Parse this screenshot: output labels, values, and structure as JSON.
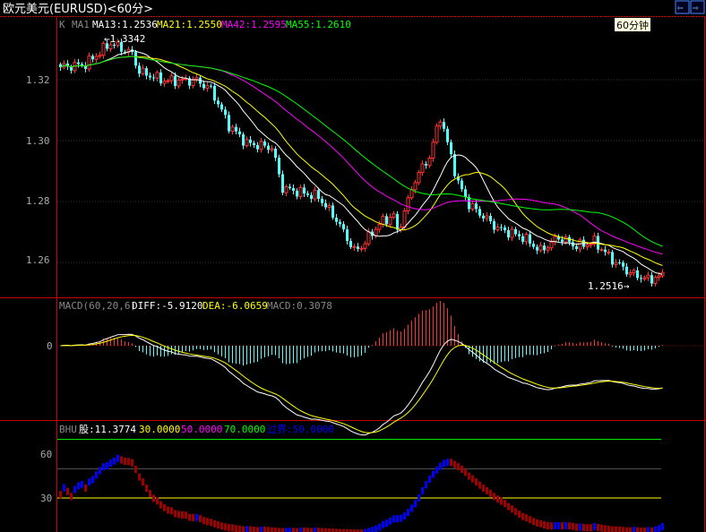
{
  "header": {
    "title": "欧元美元(EURUSD)<60分>",
    "period_badge": "60分钟",
    "nav_left_icon": "arrow-left-icon",
    "nav_right_icon": "arrow-right-icon"
  },
  "main_legend": {
    "k": "K",
    "ma1": "MA1",
    "ma13": "MA13:1.2536",
    "ma21": "MA21:1.2550",
    "ma42": "MA42:1.2595",
    "ma55": "MA55:1.2610"
  },
  "macd_legend": {
    "name": "MACD(60,20,6)",
    "diff": "DIFF:-5.9120",
    "dea": "DEA:-6.0659",
    "macd": "MACD:0.3078"
  },
  "bhu_legend": {
    "name": "BHU",
    "gu": "股:11.3774",
    "l30": "30.0000",
    "l50": "50.0000",
    "l70": "70.0000",
    "cross": "过界:50.0000"
  },
  "colors": {
    "up": "#ff3232",
    "down": "#54ffff",
    "ma13": "#ffffff",
    "ma21": "#ffff00",
    "ma42": "#ff00ff",
    "ma55": "#00ff00",
    "grid": "#ff0000",
    "bhu_up": "#0000ff",
    "bhu_down": "#a00000"
  },
  "chart_data": [
    {
      "type": "candlestick",
      "title": "欧元美元(EURUSD) 60分",
      "y_ticks": [
        "1.32",
        "1.30",
        "1.28",
        "1.26"
      ],
      "y_tick_values": [
        1.32,
        1.3,
        1.28,
        1.26
      ],
      "ylim": [
        1.2488,
        1.341
      ],
      "annotations": {
        "high": "1.3342",
        "low": "1.2516"
      },
      "close_keypoints": [
        [
          0,
          1.3241
        ],
        [
          7,
          1.325
        ],
        [
          14,
          1.332
        ],
        [
          20,
          1.3285
        ],
        [
          22,
          1.3226
        ],
        [
          29,
          1.3197
        ],
        [
          38,
          1.3197
        ],
        [
          42,
          1.3168
        ],
        [
          47,
          1.305
        ],
        [
          52,
          1.2991
        ],
        [
          59,
          1.2977
        ],
        [
          62,
          1.2844
        ],
        [
          67,
          1.283
        ],
        [
          72,
          1.2815
        ],
        [
          77,
          1.2741
        ],
        [
          82,
          1.2638
        ],
        [
          84,
          1.2653
        ],
        [
          89,
          1.2727
        ],
        [
          93,
          1.2756
        ],
        [
          94,
          1.2697
        ],
        [
          99,
          1.2874
        ],
        [
          103,
          1.2947
        ],
        [
          106,
          1.3079
        ],
        [
          108,
          1.2991
        ],
        [
          111,
          1.2859
        ],
        [
          114,
          1.2791
        ],
        [
          122,
          1.2712
        ],
        [
          129,
          1.2683
        ],
        [
          134,
          1.2638
        ],
        [
          139,
          1.2683
        ],
        [
          144,
          1.2653
        ],
        [
          149,
          1.2668
        ],
        [
          154,
          1.2609
        ],
        [
          159,
          1.2565
        ],
        [
          164,
          1.2544
        ],
        [
          168,
          1.2556
        ]
      ],
      "ma_periods": [
        13,
        21,
        42,
        55
      ]
    },
    {
      "type": "line",
      "title": "MACD(60,20,6)",
      "y_ticks": [
        "0"
      ],
      "series": [
        {
          "name": "DIFF",
          "last": -5.912
        },
        {
          "name": "DEA",
          "last": -6.0659
        },
        {
          "name": "MACD",
          "last": 0.3078
        }
      ]
    },
    {
      "type": "line",
      "title": "BHU",
      "y_ticks": [
        "60",
        "30"
      ],
      "levels": [
        30,
        50,
        70
      ],
      "last": 11.3774,
      "ylim": [
        7,
        79
      ]
    }
  ]
}
